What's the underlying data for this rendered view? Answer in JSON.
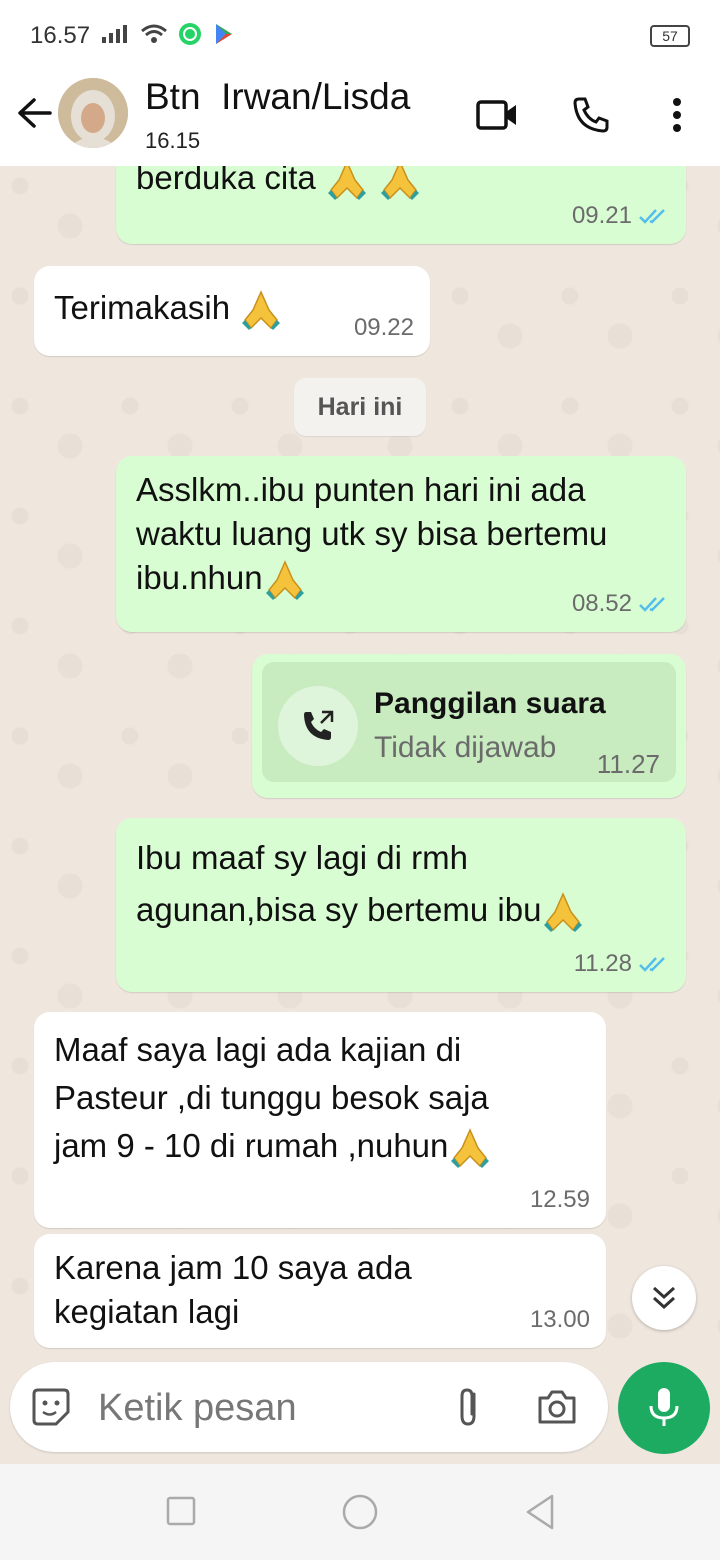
{
  "status": {
    "time": "16.57",
    "battery": "57"
  },
  "header": {
    "contact_name": "Btn  Irwan/Lisda",
    "last_seen": "16.15"
  },
  "messages": [
    {
      "dir": "out",
      "text": "berduka cita",
      "time": "09.21"
    },
    {
      "dir": "in",
      "text": "Terimakasih",
      "time": "09.22"
    },
    {
      "dir": "out",
      "lines": [
        "Assl​km..ibu punten hari ini ada",
        "waktu luang utk sy bisa bertemu",
        "ibu.nhun"
      ],
      "time": "08.52"
    },
    {
      "dir": "out",
      "lines": [
        "Ibu maaf sy lagi di rmh",
        "agunan,bisa sy bertemu ibu"
      ],
      "time": "11.28"
    },
    {
      "dir": "in",
      "lines": [
        "Maaf saya lagi ada kajian di",
        "Pasteur ,di tunggu besok saja",
        "jam 9 - 10 di rumah ,nuhun"
      ],
      "time": "12.59"
    },
    {
      "dir": "in",
      "lines": [
        "Karena jam 10 saya ada",
        "kegiatan lagi"
      ],
      "time": "13.00"
    }
  ],
  "day_separator": "Hari ini",
  "call": {
    "title": "Panggilan suara",
    "subtitle": "Tidak dijawab",
    "time": "11.27"
  },
  "composer": {
    "placeholder": "Ketik pesan"
  },
  "colors": {
    "outgoing_bubble": "#d9fdd3",
    "incoming_bubble": "#ffffff",
    "accent": "#1daa61",
    "read_ticks": "#53bdeb"
  }
}
